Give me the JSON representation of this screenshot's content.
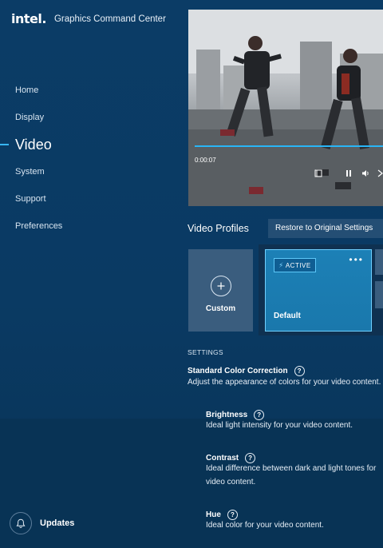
{
  "app": {
    "logo": "intel.",
    "title": "Graphics Command Center"
  },
  "sidebar": {
    "items": [
      {
        "label": "Home",
        "active": false
      },
      {
        "label": "Display",
        "active": false
      },
      {
        "label": "Video",
        "active": true
      },
      {
        "label": "System",
        "active": false
      },
      {
        "label": "Support",
        "active": false
      },
      {
        "label": "Preferences",
        "active": false
      }
    ],
    "updates_label": "Updates"
  },
  "video_player": {
    "timecode": "0:00:07",
    "progress_fraction": 1.0
  },
  "video_profiles": {
    "title": "Video Profiles",
    "restore_label": "Restore to Original Settings",
    "custom_label": "Custom",
    "default_label": "Default",
    "active_badge": "ACTIVE"
  },
  "settings": {
    "heading": "SETTINGS",
    "standard_color": {
      "title": "Standard Color Correction",
      "desc": "Adjust the appearance of colors for your video content."
    },
    "brightness": {
      "title": "Brightness",
      "desc": "Ideal light intensity for your video content."
    },
    "contrast": {
      "title": "Contrast",
      "desc_line1": "Ideal difference between dark and light tones for",
      "desc_line2": "video content."
    },
    "hue": {
      "title": "Hue",
      "desc": "Ideal color for your video content."
    }
  },
  "colors": {
    "accent": "#29b5f6",
    "background": "#0a3a63",
    "card": "#3a5d7e",
    "active_card": "#1c80b6"
  }
}
